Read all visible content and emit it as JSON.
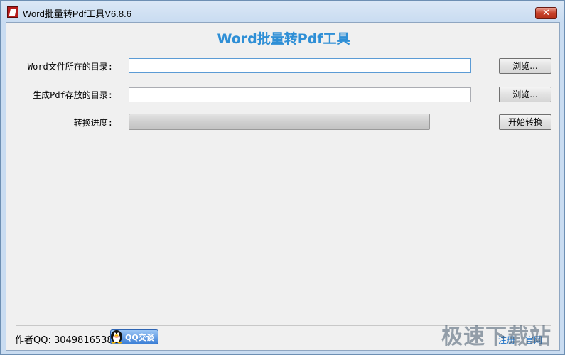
{
  "window": {
    "title": "Word批量转Pdf工具V6.8.6",
    "close_label": "✕"
  },
  "main": {
    "heading": "Word批量转Pdf工具",
    "rows": {
      "source_dir": {
        "label": "Word文件所在的目录:",
        "value": "",
        "browse_label": "浏览..."
      },
      "output_dir": {
        "label": "生成Pdf存放的目录:",
        "value": "",
        "browse_label": "浏览..."
      },
      "progress": {
        "label": "转换进度:",
        "value_percent": 0,
        "start_label": "开始转换"
      }
    },
    "log_text": ""
  },
  "footer": {
    "author_text": "作者QQ: 3049816538",
    "qq_chat_label": "QQ交谈",
    "register_link": "注册",
    "website_link": "官网"
  },
  "watermark": "极速下载站",
  "colors": {
    "heading": "#2f8fd6",
    "progress_track": "#cfcfcf",
    "close_button": "#c7412a"
  },
  "icons": {
    "app": "word-to-pdf-app-icon",
    "qq": "qq-penguin-icon"
  }
}
